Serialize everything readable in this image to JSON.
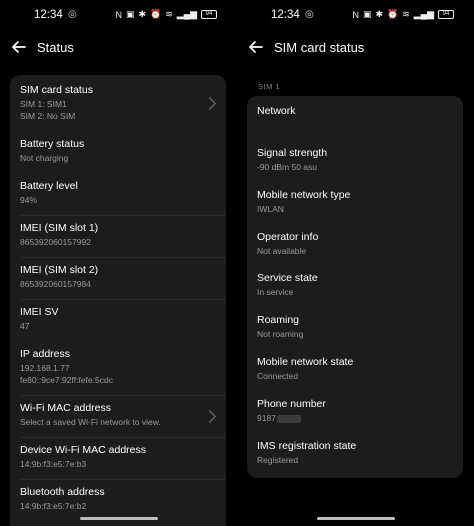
{
  "left": {
    "status_bar": {
      "time": "12:34",
      "battery": "94"
    },
    "title": "Status",
    "items": [
      {
        "title": "SIM card status",
        "sub1": "SIM 1: SIM1",
        "sub2": "SIM 2: No SIM"
      },
      {
        "title": "Battery status",
        "sub1": "Not charging"
      },
      {
        "title": "Battery level",
        "sub1": "94%"
      },
      {
        "title": "IMEI (SIM slot 1)",
        "sub1": "865392060157992"
      },
      {
        "title": "IMEI (SIM slot 2)",
        "sub1": "865392060157984"
      },
      {
        "title": "IMEI SV",
        "sub1": "47"
      },
      {
        "title": "IP address",
        "sub1": "192.168.1.77",
        "sub2": "fe80::9ce7:92ff:fefe:5cdc"
      },
      {
        "title": "Wi-Fi MAC address",
        "sub1": "Select a saved Wi-Fi network to view."
      },
      {
        "title": "Device Wi-Fi MAC address",
        "sub1": "14:9b:f3:e5:7e:b3"
      },
      {
        "title": "Bluetooth address",
        "sub1": "14:9b:f3:e5:7e:b2"
      }
    ]
  },
  "right": {
    "status_bar": {
      "time": "12:34",
      "battery": "94"
    },
    "title": "SIM card status",
    "section": "SIM 1",
    "items": [
      {
        "title": "Network",
        "sub1": ""
      },
      {
        "title": "Signal strength",
        "sub1": "-90 dBm 50 asu"
      },
      {
        "title": "Mobile network type",
        "sub1": "IWLAN"
      },
      {
        "title": "Operator info",
        "sub1": "Not available"
      },
      {
        "title": "Service state",
        "sub1": "In service"
      },
      {
        "title": "Roaming",
        "sub1": "Not roaming"
      },
      {
        "title": "Mobile network state",
        "sub1": "Connected"
      },
      {
        "title": "Phone number",
        "sub1": "9187"
      },
      {
        "title": "IMS registration state",
        "sub1": "Registered"
      }
    ]
  }
}
